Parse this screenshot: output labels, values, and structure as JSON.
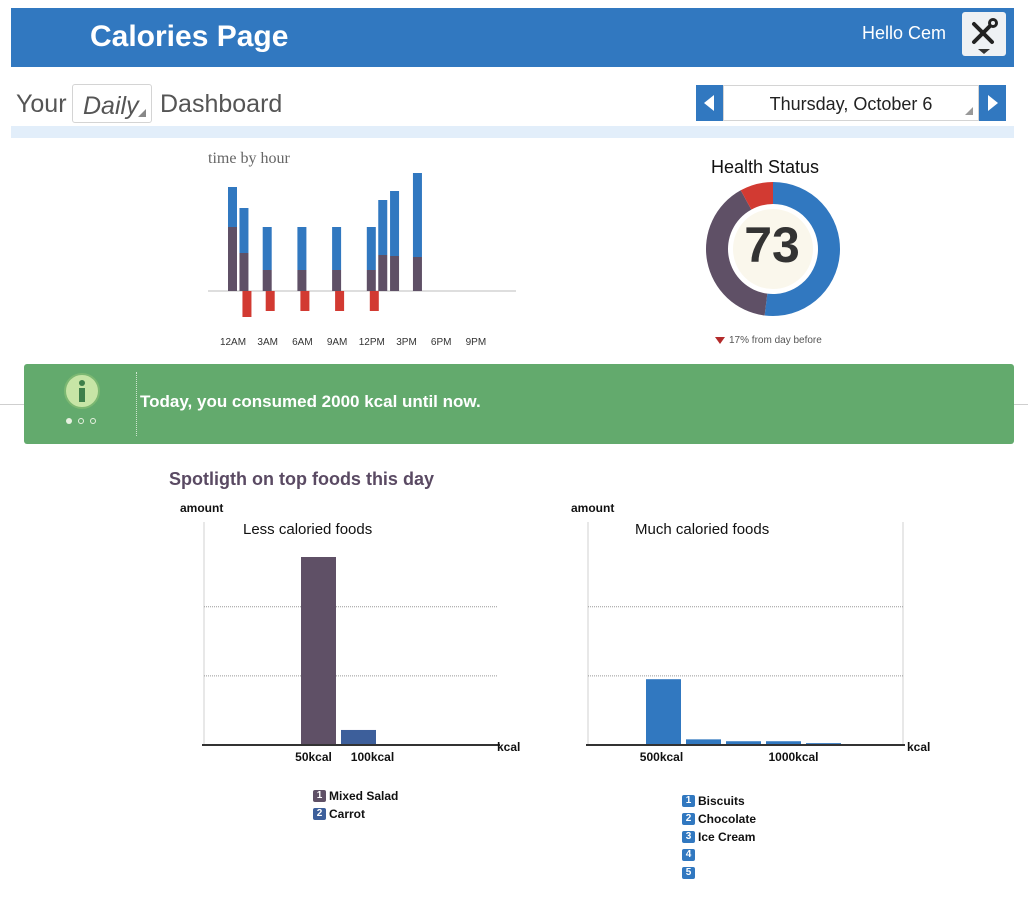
{
  "header": {
    "title": "Calories Page",
    "greeting": "Hello Cem",
    "settings_icon": "tools-icon"
  },
  "dashboard": {
    "prefix": "Your",
    "period": "Daily",
    "suffix": "Dashboard",
    "date": "Thursday, October 6"
  },
  "hour_chart": {
    "title": "time by hour",
    "colors": {
      "positive_top": "#3178c0",
      "positive_base": "#5f5066",
      "negative": "#d23a32"
    },
    "chart_data": {
      "type": "bar",
      "title": "time by hour",
      "categories": [
        "12AM",
        "3AM",
        "6AM",
        "9AM",
        "12PM",
        "3PM",
        "6PM",
        "9PM"
      ],
      "bars": [
        {
          "slot": 0.0,
          "blue": 40,
          "purple": 64,
          "red": 0
        },
        {
          "slot": 0.33,
          "blue": 45,
          "purple": 38,
          "red": 26
        },
        {
          "slot": 1.0,
          "blue": 43,
          "purple": 21,
          "red": 20
        },
        {
          "slot": 2.0,
          "blue": 43,
          "purple": 21,
          "red": 20
        },
        {
          "slot": 3.0,
          "blue": 43,
          "purple": 21,
          "red": 20
        },
        {
          "slot": 4.0,
          "blue": 43,
          "purple": 21,
          "red": 20
        },
        {
          "slot": 4.33,
          "blue": 55,
          "purple": 36,
          "red": 0
        },
        {
          "slot": 4.67,
          "blue": 65,
          "purple": 35,
          "red": 0
        },
        {
          "slot": 5.33,
          "blue": 84,
          "purple": 34,
          "red": 0
        }
      ]
    }
  },
  "health": {
    "title": "Health Status",
    "score": "73",
    "delta_text": "17% from day before",
    "colors": {
      "good": "#3178c0",
      "neutral": "#5f5066",
      "bad": "#d23a32"
    },
    "segments": [
      {
        "name": "good",
        "fraction": 0.52
      },
      {
        "name": "neutral",
        "fraction": 0.4
      },
      {
        "name": "bad",
        "fraction": 0.08
      }
    ]
  },
  "banner": {
    "text": "Today, you consumed 2000 kcal until now.",
    "icon": "info-icon"
  },
  "foods": {
    "title": "Spotligth on top foods this day",
    "less": {
      "chart_title": "Less caloried foods",
      "ylabel": "amount",
      "xlabel": "kcal",
      "color_1": "#5f5066",
      "color_2": "#3d5f9b",
      "chart_data": {
        "type": "bar",
        "title": "Less caloried foods",
        "categories": [
          "50kcal",
          "100kcal"
        ],
        "values": [
          100,
          8
        ],
        "ylim": [
          0,
          100
        ]
      },
      "legend": [
        {
          "num": "1",
          "label": "Mixed Salad"
        },
        {
          "num": "2",
          "label": "Carrot"
        }
      ]
    },
    "much": {
      "chart_title": "Much caloried foods",
      "ylabel": "amount",
      "xlabel": "kcal",
      "color": "#3178c0",
      "chart_data": {
        "type": "bar",
        "title": "Much caloried foods",
        "categories": [
          "500kcal",
          "",
          "",
          "1000kcal",
          ""
        ],
        "values": [
          35,
          3,
          2,
          2,
          1
        ],
        "ylim": [
          0,
          100
        ]
      },
      "legend": [
        {
          "num": "1",
          "label": "Biscuits"
        },
        {
          "num": "2",
          "label": "Chocolate"
        },
        {
          "num": "3",
          "label": "Ice Cream"
        },
        {
          "num": "4",
          "label": ""
        },
        {
          "num": "5",
          "label": ""
        }
      ]
    }
  }
}
